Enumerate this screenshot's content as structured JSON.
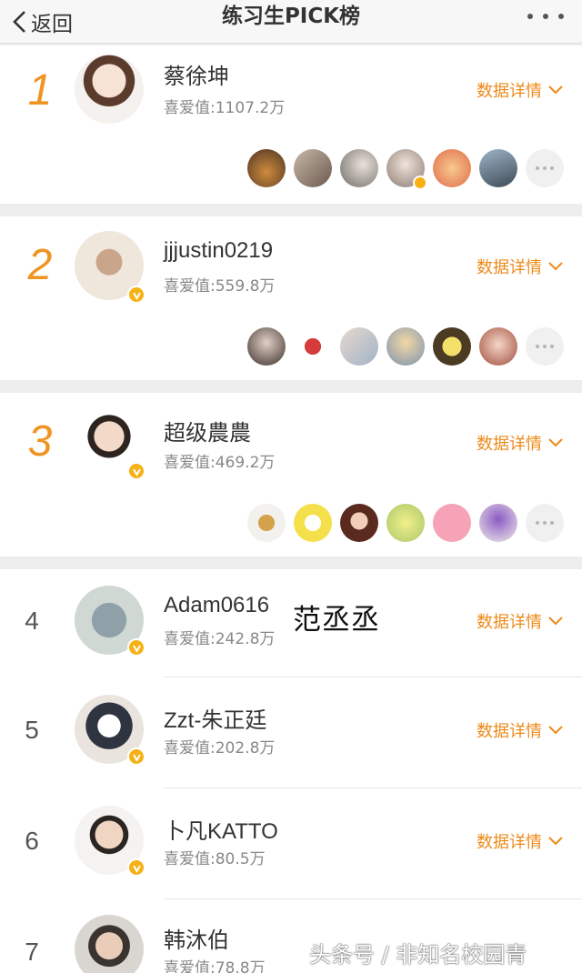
{
  "nav": {
    "back_label": "返回",
    "title": "练习生PICK榜"
  },
  "labels": {
    "detail": "数据详情"
  },
  "top3": [
    {
      "rank": "1",
      "name": "蔡徐坤",
      "score": "喜爱值:1107.2万",
      "verified": false
    },
    {
      "rank": "2",
      "name": "jjjustin0219",
      "score": "喜爱值:559.8万",
      "verified": true
    },
    {
      "rank": "3",
      "name": "超级農農",
      "score": "喜爱值:469.2万",
      "verified": true
    }
  ],
  "list": [
    {
      "rank": "4",
      "name": "Adam0616",
      "score": "喜爱值:242.8万",
      "verified": true
    },
    {
      "rank": "5",
      "name": "Zzt-朱正廷",
      "score": "喜爱值:202.8万",
      "verified": true
    },
    {
      "rank": "6",
      "name": "卜凡KATTO",
      "score": "喜爱值:80.5万",
      "verified": true
    },
    {
      "rank": "7",
      "name": "韩沐伯",
      "score": "喜爱值:78.8万",
      "verified": false
    }
  ],
  "annotation": "范丞丞",
  "watermark": "头条号 / 非知名校园青",
  "colors": {
    "accent_orange": "#f09422",
    "verified_gold": "#f6b114",
    "link_orange": "#ed8a19",
    "background": "#ededed"
  }
}
